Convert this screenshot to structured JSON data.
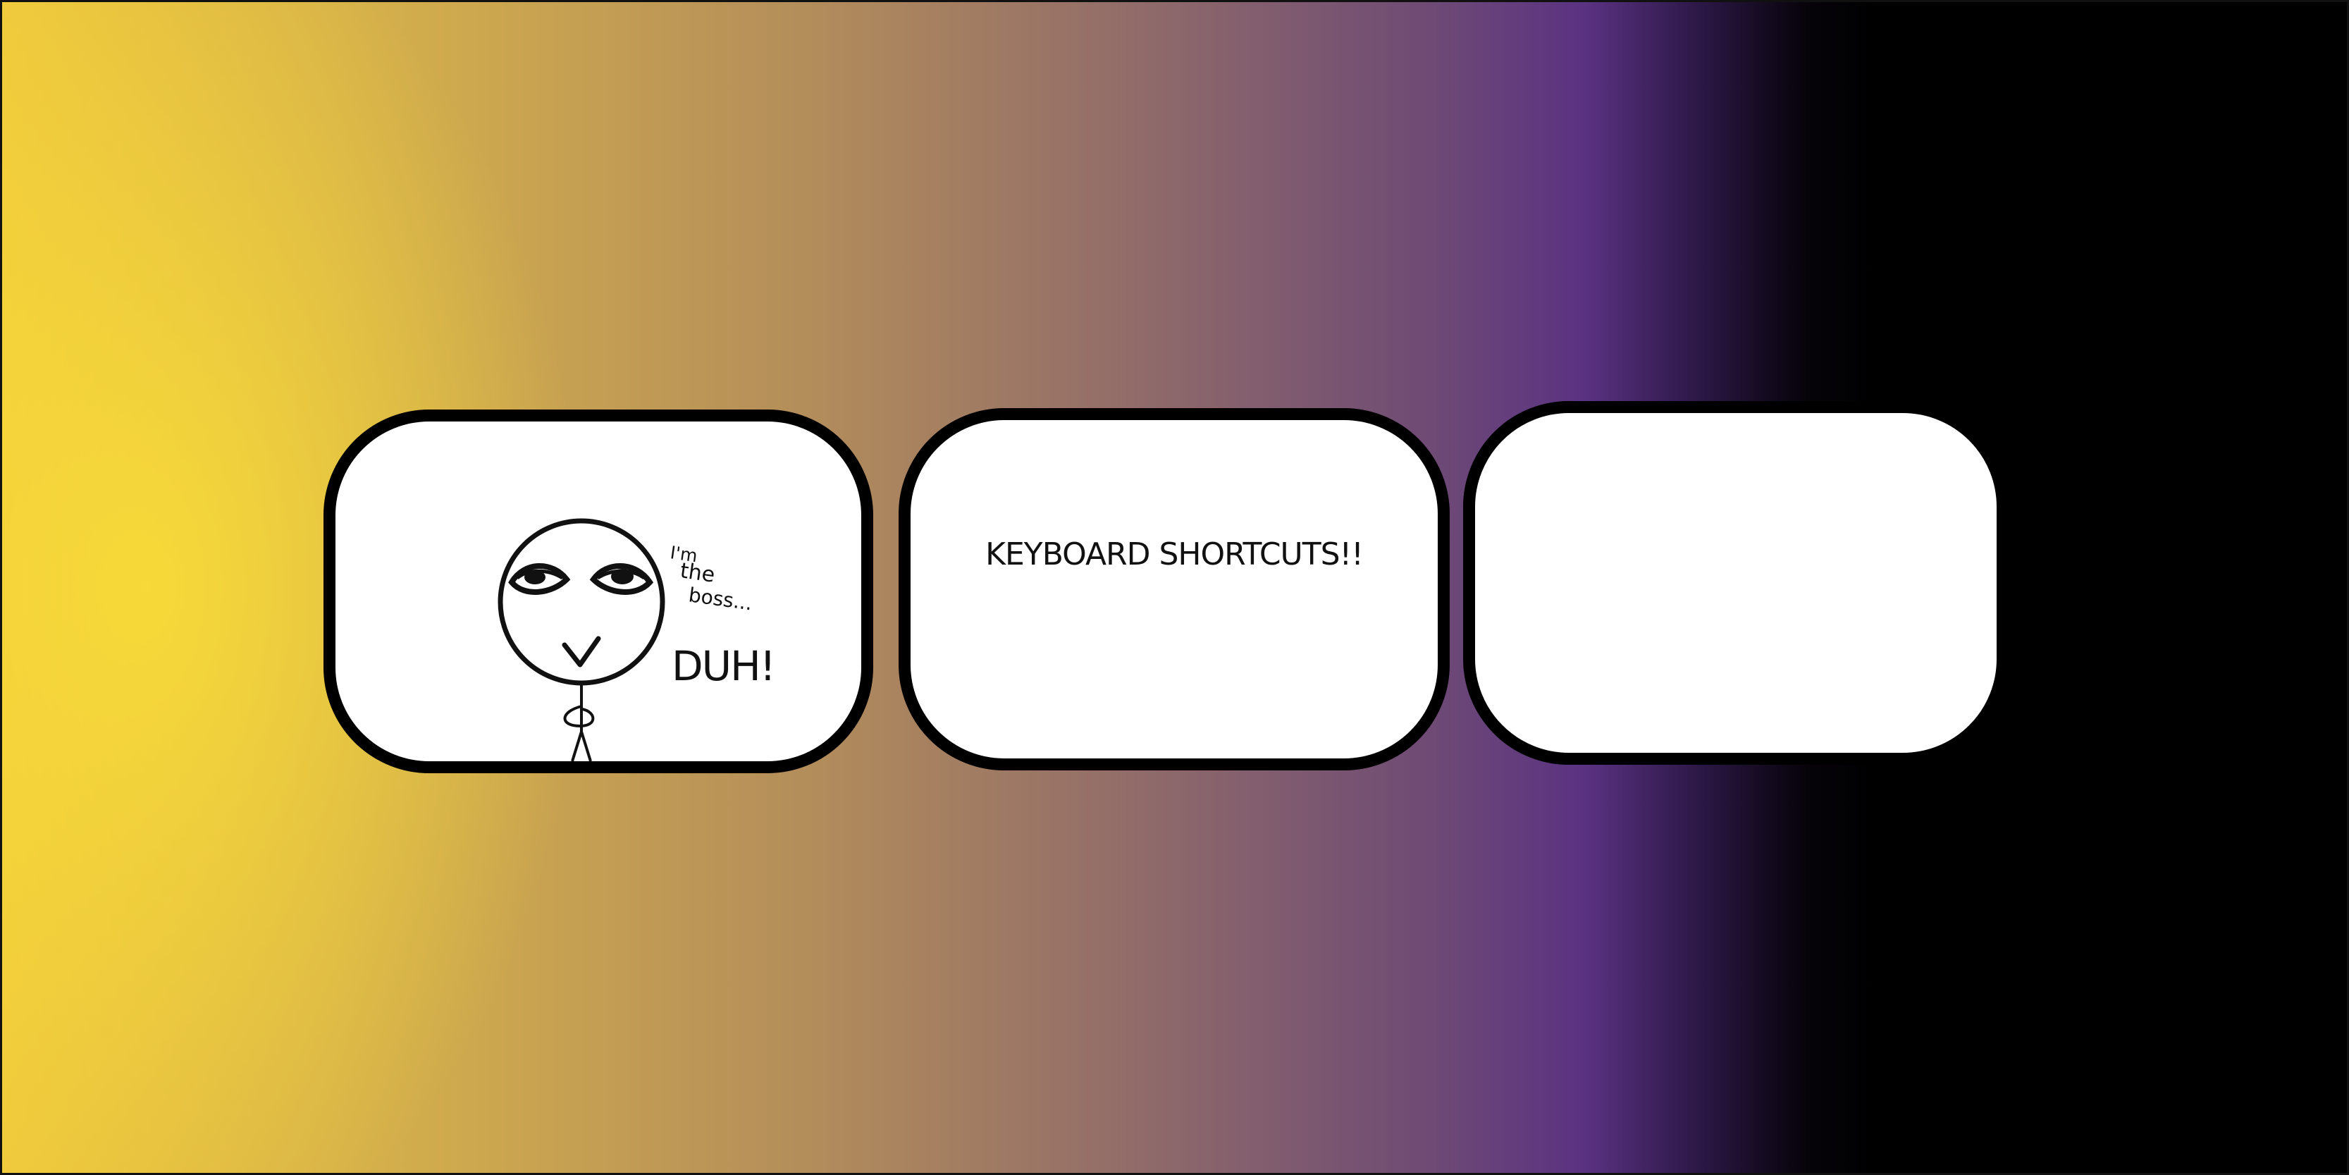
{
  "panels": [
    {
      "name": "boss-comic-panel",
      "speech": {
        "line_1": "I'm",
        "line_2": "the",
        "line_3": "boss...",
        "exclamation": "DUH!"
      }
    },
    {
      "name": "keyboard-shortcuts-panel",
      "title": "KEYBOARD SHORTCUTS!!"
    },
    {
      "name": "blank-panel"
    }
  ],
  "colors": {
    "gradient_yellow": "#efc93c",
    "gradient_purple": "#5a3282",
    "gradient_black": "#000000",
    "panel_fill": "#ffffff",
    "panel_border": "#000000"
  }
}
